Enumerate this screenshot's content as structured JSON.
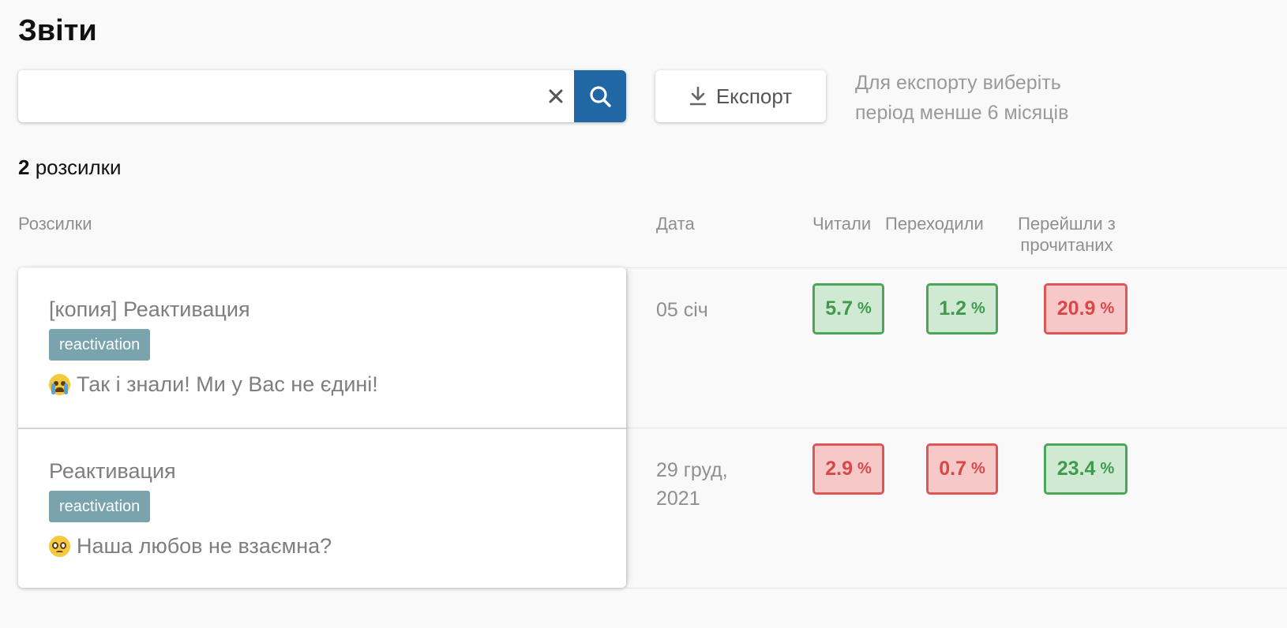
{
  "page": {
    "title": "Звіти"
  },
  "search": {
    "value": "",
    "placeholder": "",
    "clear_label": "×"
  },
  "export": {
    "button_label": "Експорт",
    "hint": "Для експорту виберіть період менше 6 місяців"
  },
  "summary": {
    "count": "2",
    "count_label": "розсилки"
  },
  "table": {
    "headers": {
      "name": "Розсилки",
      "date": "Дата",
      "read": "Читали",
      "clicked": "Переходили",
      "ctr_line1": "Перейшли з",
      "ctr_line2": "прочитаних"
    },
    "rows": [
      {
        "title": "[копия] Реактивация",
        "tag": "reactivation",
        "subject_emoji": "loudly-crying-face-icon",
        "subject": "Так і знали! Ми у Вас не єдині!",
        "date": "05 січ",
        "date_line2": "",
        "read": "5.7",
        "read_status": "good",
        "clicked": "1.2",
        "clicked_status": "good",
        "ctr": "20.9",
        "ctr_status": "bad"
      },
      {
        "title": "Реактивация",
        "tag": "reactivation",
        "subject_emoji": "pleading-face-icon",
        "subject": "Наша любов не взаємна?",
        "date": "29 груд,",
        "date_line2": "2021",
        "read": "2.9",
        "read_status": "bad",
        "clicked": "0.7",
        "clicked_status": "bad",
        "ctr": "23.4",
        "ctr_status": "good"
      }
    ],
    "percent_sign": "%"
  },
  "colors": {
    "primary": "#2166a5",
    "tag_bg": "#79a4ae",
    "good_bg": "#cfe9d3",
    "good_border": "#4ca65a",
    "bad_bg": "#f6c8c8",
    "bad_border": "#de5757"
  }
}
